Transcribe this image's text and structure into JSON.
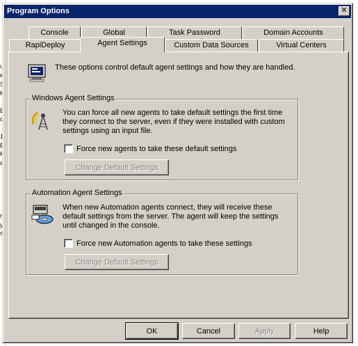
{
  "window": {
    "title": "Program Options"
  },
  "tabs_back": [
    {
      "label": "Console"
    },
    {
      "label": "Global"
    },
    {
      "label": "Task Password"
    },
    {
      "label": "Domain Accounts"
    }
  ],
  "tabs_front": [
    {
      "label": "RapiDeploy"
    },
    {
      "label": "Agent Settings",
      "active": true
    },
    {
      "label": "Custom Data Sources"
    },
    {
      "label": "Virtual Centers"
    }
  ],
  "intro": {
    "text": "These options control default agent settings and how they are handled."
  },
  "windows_agent": {
    "legend": "Windows Agent Settings",
    "description": "You can force all new agents to take default settings the first time they connect to the server, even if they were installed with custom settings using an input file.",
    "checkbox_label": "Force new agents to take these default settings",
    "checked": false,
    "button_label": "Change Default Settings"
  },
  "automation_agent": {
    "legend": "Automation Agent Settings",
    "description": "When new Automation agents connect, they will receive these default settings from the server.  The agent will keep the settings until changed in the console.",
    "checkbox_label": "Force new Automation agents to take these settings",
    "checked": false,
    "button_label": "Change Default Settings"
  },
  "footer": {
    "ok_label": "OK",
    "cancel_label": "Cancel",
    "apply_label": "Apply",
    "help_label": "Help"
  },
  "icons": {
    "intro": "monitor-settings-icon",
    "windows_agent": "antenna-tower-icon",
    "automation_agent": "automation-disk-icon"
  },
  "colors": {
    "titlebar": "#0a246a",
    "face": "#d4d0c8",
    "disabled_text": "#808080"
  }
}
